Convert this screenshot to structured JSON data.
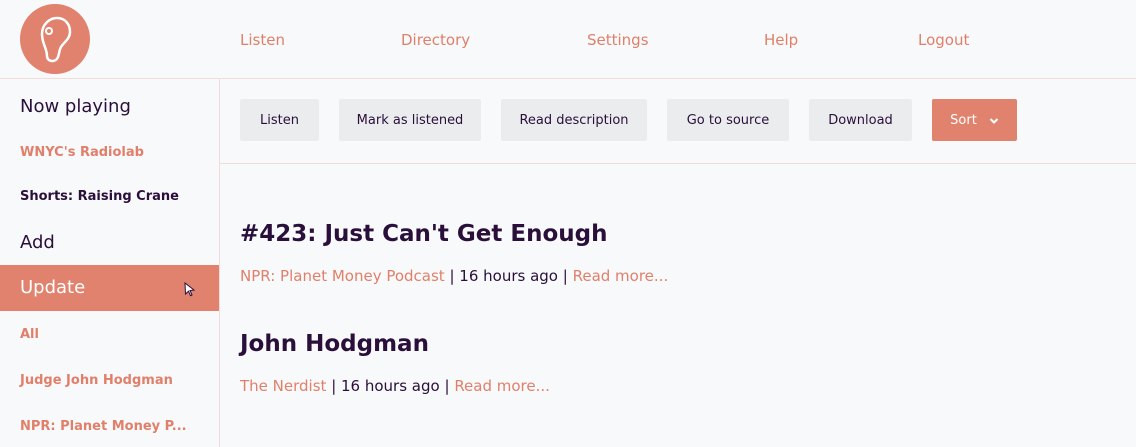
{
  "nav": {
    "listen": "Listen",
    "directory": "Directory",
    "settings": "Settings",
    "help": "Help",
    "logout": "Logout"
  },
  "sidebar": {
    "now_playing": "Now playing",
    "now_playing_podcast": "WNYC's Radiolab",
    "now_playing_episode": "Shorts: Raising Crane",
    "add": "Add",
    "update": "Update",
    "feeds": [
      "All",
      "Judge John Hodgman",
      "NPR: Planet Money P..."
    ]
  },
  "toolbar": {
    "listen": "Listen",
    "mark_listened": "Mark as listened",
    "read_description": "Read description",
    "go_to_source": "Go to source",
    "download": "Download",
    "sort": "Sort"
  },
  "episodes": [
    {
      "title": "#423: Just Can't Get Enough",
      "source": "NPR: Planet Money Podcast",
      "time": "16 hours ago",
      "more": "Read more..."
    },
    {
      "title": "John Hodgman",
      "source": "The Nerdist",
      "time": "16 hours ago",
      "more": "Read more..."
    }
  ],
  "colors": {
    "accent": "#e0826d",
    "text": "#2a0f3b",
    "button_bg": "#ebeced",
    "background": "#f8f9fb"
  }
}
